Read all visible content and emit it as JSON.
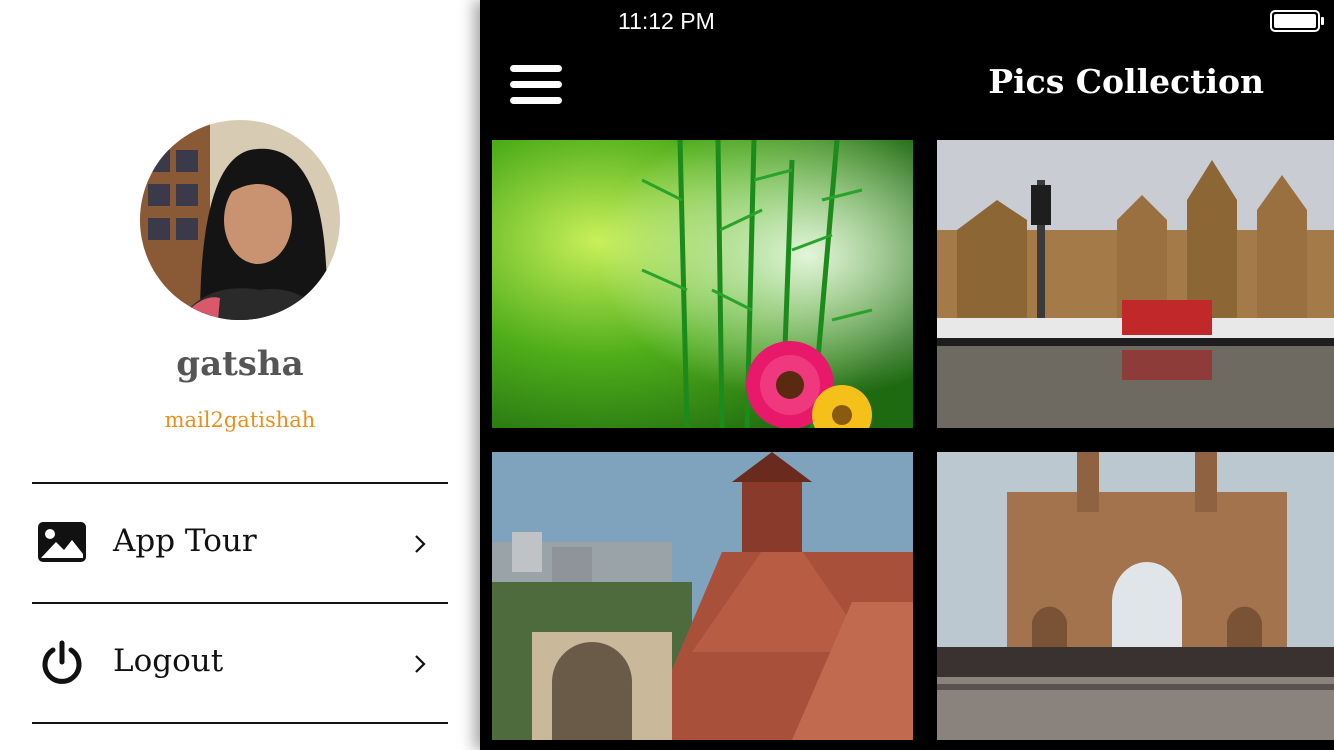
{
  "status_bar": {
    "time": "11:12 PM",
    "battery_icon": "battery-full-icon"
  },
  "header": {
    "title": "Pics Collection",
    "menu_icon": "hamburger-menu-icon"
  },
  "drawer": {
    "user": {
      "name": "gatsha",
      "email": "mail2gatishah"
    },
    "menu_items": [
      {
        "label": "App Tour",
        "icon": "image-icon",
        "chevron": "chevron-right-icon"
      },
      {
        "label": "Logout",
        "icon": "power-icon",
        "chevron": "chevron-right-icon"
      }
    ]
  },
  "gallery": {
    "photos": [
      {
        "subject": "bamboo-flower"
      },
      {
        "subject": "cst-station"
      },
      {
        "subject": "market-rooftops"
      },
      {
        "subject": "gateway-of-india"
      }
    ]
  },
  "colors": {
    "accent_email": "#e8901c",
    "header_background": "#000000",
    "drawer_background": "#ffffff",
    "text_dark": "#111111",
    "name_gray": "#555555"
  }
}
